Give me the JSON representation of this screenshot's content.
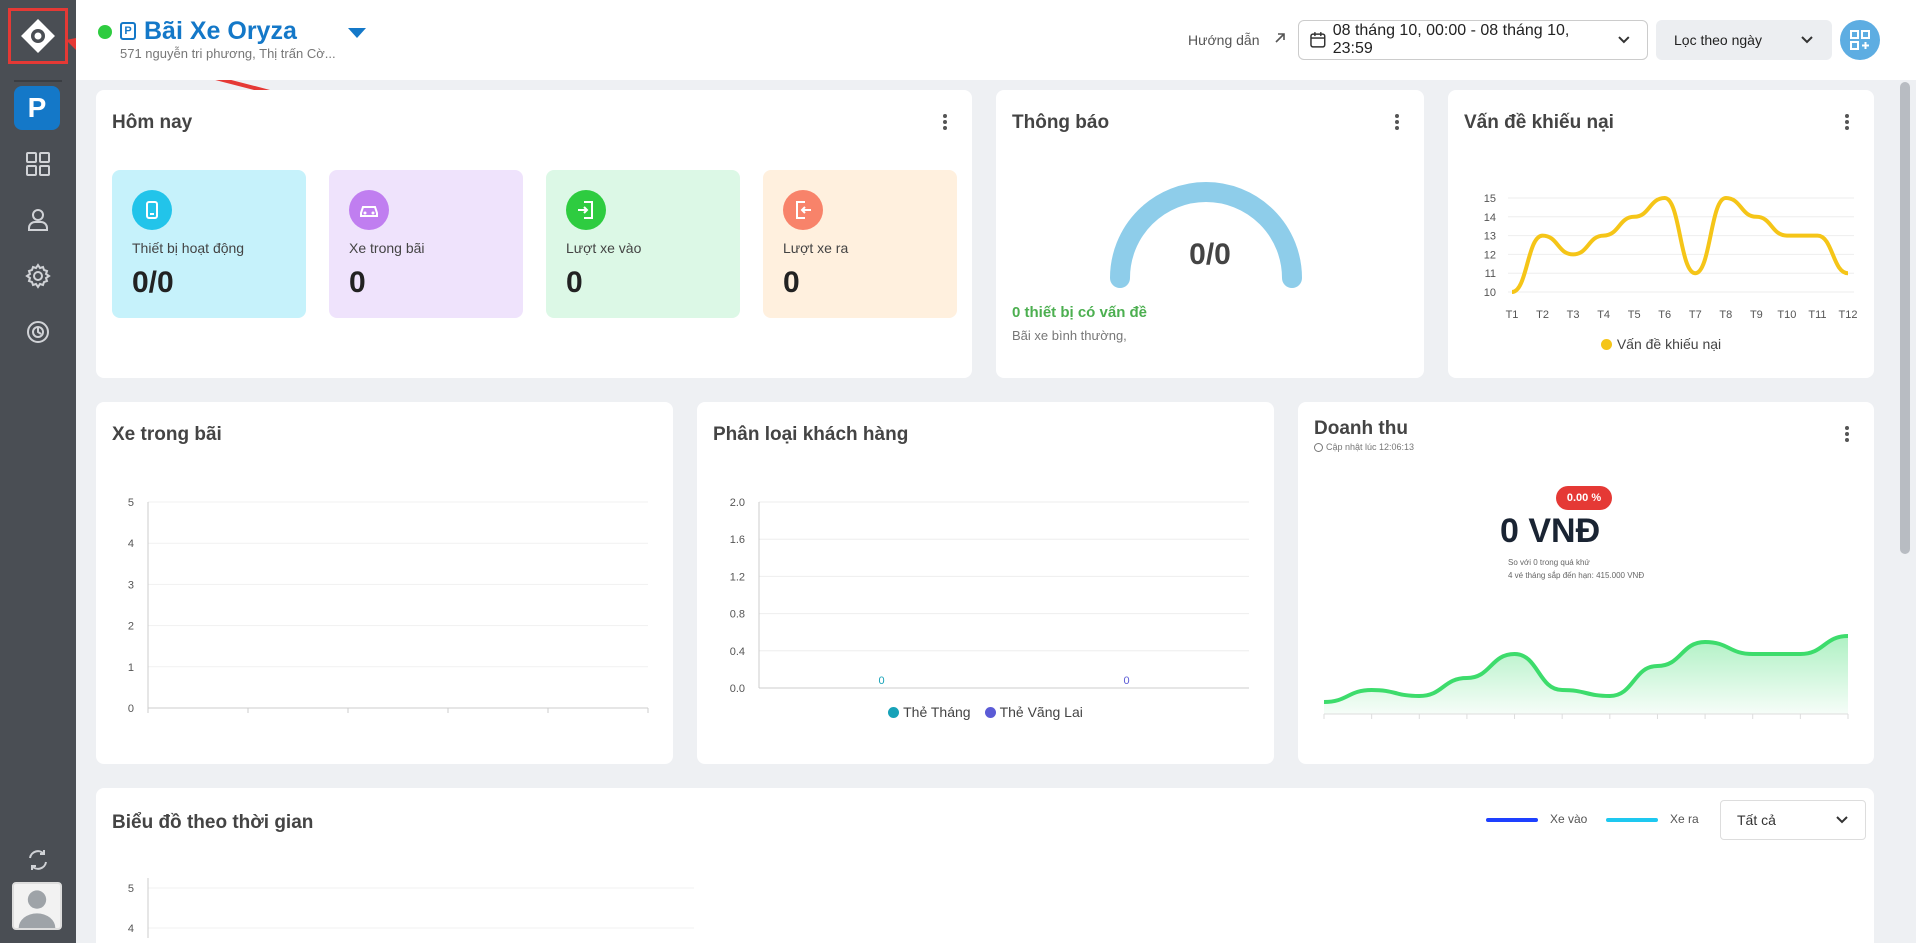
{
  "header": {
    "site_name": "Bãi Xe Oryza",
    "site_address": "571 nguyễn tri phương, Thị trấn Cờ...",
    "p_badge": "P",
    "guide_label": "Hướng dẫn",
    "date_range": "08 tháng 10, 00:00 - 08 tháng 10, 23:59",
    "filter_label": "Lọc theo ngày"
  },
  "sidebar": {
    "p_label": "P"
  },
  "today": {
    "title": "Hôm nay",
    "stats": [
      {
        "label": "Thiết bị hoạt động",
        "value": "0/0",
        "bg": "#c6f2fb",
        "icon_bg": "#22c4ea",
        "icon": "device-icon"
      },
      {
        "label": "Xe trong bãi",
        "value": "0",
        "bg": "#efe3fc",
        "icon_bg": "#c07ef0",
        "icon": "car-icon"
      },
      {
        "label": "Lượt xe vào",
        "value": "0",
        "bg": "#dcf8e6",
        "icon_bg": "#2ecc40",
        "icon": "enter-icon"
      },
      {
        "label": "Lượt xe ra",
        "value": "0",
        "bg": "#fff0de",
        "icon_bg": "#f8836a",
        "icon": "exit-icon"
      }
    ]
  },
  "notify": {
    "title": "Thông báo",
    "gauge_value": "0/0",
    "issue_text": "0 thiết bị có vấn đề",
    "status_text": "Bãi xe bình thường,"
  },
  "complaints": {
    "title": "Vấn đề khiếu nại",
    "legend": "Vấn đề khiếu nại",
    "color": "#f5c518"
  },
  "parked": {
    "title": "Xe trong bãi"
  },
  "customer": {
    "title": "Phân loại khách hàng",
    "legend": [
      "Thẻ Tháng",
      "Thẻ Vãng Lai"
    ],
    "colors": [
      "#17a2b8",
      "#5b5bd6"
    ],
    "labels": [
      "0",
      "0"
    ]
  },
  "revenue": {
    "title": "Doanh thu",
    "updated": "Cập nhật lúc 12:06:13",
    "badge": "0.00 %",
    "amount": "0 VNĐ",
    "note1": "So với 0 trong quá khứ",
    "note2": "4 vé tháng sắp đến hạn: 415.000 VNĐ"
  },
  "timeline": {
    "title": "Biểu đồ theo thời gian",
    "legend_in": "Xe vào",
    "legend_out": "Xe ra",
    "select_value": "Tất cả",
    "color_in": "#1e40ff",
    "color_out": "#1ec8f0"
  },
  "chart_data": [
    {
      "type": "line",
      "title": "Vấn đề khiếu nại",
      "categories": [
        "T1",
        "T2",
        "T3",
        "T4",
        "T5",
        "T6",
        "T7",
        "T8",
        "T9",
        "T10",
        "T11",
        "T12"
      ],
      "series": [
        {
          "name": "Vấn đề khiếu nại",
          "values": [
            10,
            13,
            12,
            13,
            14,
            15,
            11,
            15,
            14,
            13,
            13,
            11
          ]
        }
      ],
      "ylim": [
        10,
        15
      ],
      "yticks": [
        "10",
        "11",
        "12",
        "13",
        "14",
        "15"
      ],
      "grid": true,
      "legend": "bottom"
    },
    {
      "type": "line",
      "title": "Xe trong bãi",
      "series": [],
      "ylim": [
        0,
        5
      ],
      "yticks": [
        "0",
        "1",
        "2",
        "3",
        "4",
        "5"
      ],
      "grid": true
    },
    {
      "type": "bar",
      "title": "Phân loại khách hàng",
      "series": [
        {
          "name": "Thẻ Tháng",
          "values": [
            0
          ]
        },
        {
          "name": "Thẻ Vãng Lai",
          "values": [
            0
          ]
        }
      ],
      "ylim": [
        0,
        2
      ],
      "yticks": [
        "0.0",
        "0.4",
        "0.8",
        "1.2",
        "1.6",
        "2.0"
      ],
      "grid": true,
      "legend": "bottom"
    },
    {
      "type": "area",
      "title": "Doanh thu",
      "values": [
        1,
        2,
        1.5,
        3,
        5,
        2,
        1.5,
        4,
        6,
        5,
        5,
        6.5
      ],
      "ylim": [
        0,
        8
      ],
      "grid": false
    },
    {
      "type": "line",
      "title": "Biểu đồ theo thời gian",
      "series": [
        {
          "name": "Xe vào",
          "values": []
        },
        {
          "name": "Xe ra",
          "values": []
        }
      ],
      "yticks": [
        "4",
        "5"
      ],
      "legend": "top-right"
    }
  ]
}
